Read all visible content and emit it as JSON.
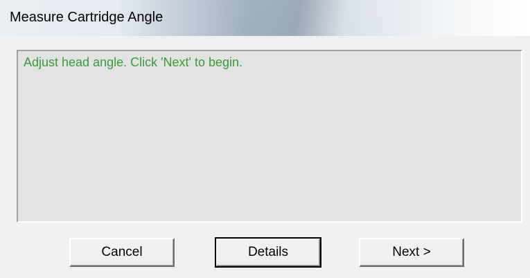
{
  "window": {
    "title": "Measure Cartridge Angle"
  },
  "message": {
    "text": "Adjust head angle. Click 'Next' to begin.",
    "color": "#3a9a3a"
  },
  "buttons": {
    "cancel_label": "Cancel",
    "details_label": "Details",
    "next_label": "Next >"
  }
}
